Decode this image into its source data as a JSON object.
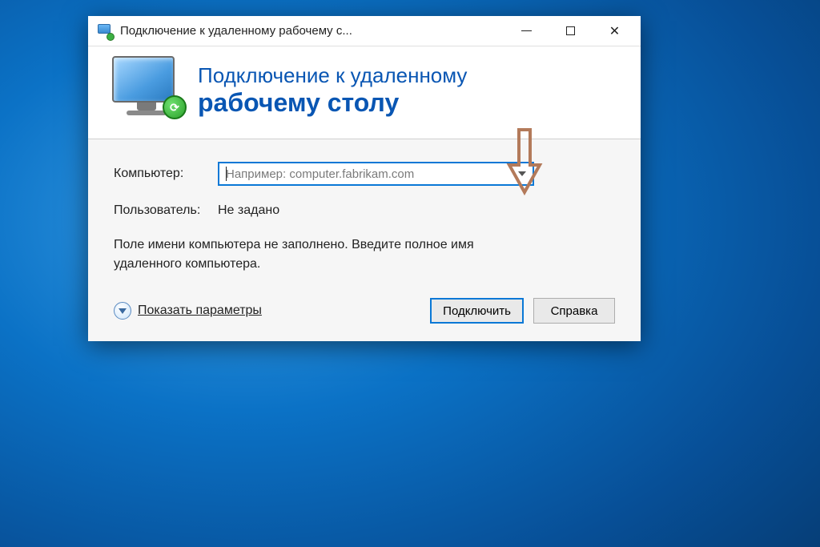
{
  "titlebar": {
    "title": "Подключение к удаленному рабочему с..."
  },
  "header": {
    "line1": "Подключение к удаленному",
    "line2": "рабочему столу"
  },
  "form": {
    "computer_label": "Компьютер:",
    "computer_placeholder": "Например: computer.fabrikam.com",
    "computer_value": "",
    "user_label": "Пользователь:",
    "user_value": "Не задано"
  },
  "hint": "Поле имени компьютера не заполнено. Введите полное имя удаленного компьютера.",
  "footer": {
    "show_options": "Показать параметры",
    "connect": "Подключить",
    "help": "Справка"
  },
  "colors": {
    "accent": "#0a78d6",
    "header_text": "#0956b3"
  }
}
